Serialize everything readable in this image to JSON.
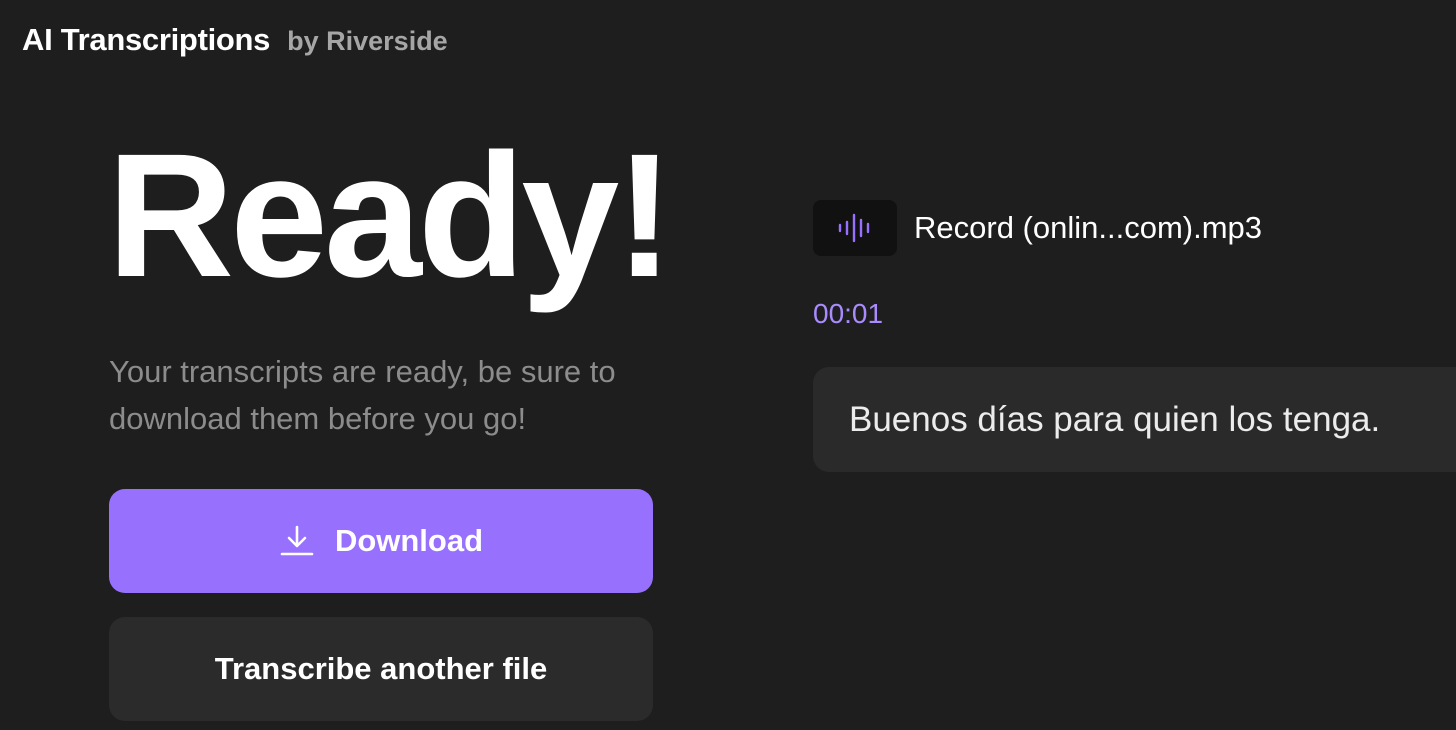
{
  "header": {
    "title": "AI Transcriptions",
    "byline": "by Riverside"
  },
  "hero": {
    "heading": "Ready!",
    "subtitle": "Your transcripts are ready, be sure to download them before you go!"
  },
  "actions": {
    "download_label": "Download",
    "download_icon": "download-icon",
    "transcribe_another_label": "Transcribe another file"
  },
  "file": {
    "icon": "audio-waveform-icon",
    "name": "Record (onlin...com).mp3"
  },
  "transcript": {
    "segments": [
      {
        "timestamp": "00:01",
        "text": "Buenos días para quien los tenga."
      }
    ]
  },
  "colors": {
    "background": "#1e1e1e",
    "accent": "#9771fd",
    "timestamp": "#a98bff",
    "card": "#2a2a2a"
  }
}
